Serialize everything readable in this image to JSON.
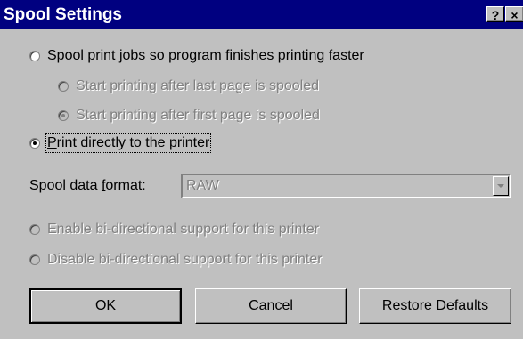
{
  "window": {
    "title": "Spool Settings",
    "help_label": "?",
    "close_label": "×"
  },
  "spool": {
    "main_label": "Spool print jobs so program finishes printing faster",
    "main_mnemonic": "S",
    "main_rest": "pool print jobs so program finishes printing faster",
    "after_last_label": "Start printing after last page is spooled",
    "after_first_label": "Start printing after first page is spooled",
    "direct_mnemonic": "P",
    "direct_rest": "rint directly to the printer"
  },
  "format": {
    "label_pre": "Spool data ",
    "label_mnemonic": "f",
    "label_post": "ormat:",
    "selected": "RAW"
  },
  "bidi": {
    "enable_label": "Enable bi-directional support for this printer",
    "disable_label": "Disable bi-directional support for this printer"
  },
  "buttons": {
    "ok_label": "OK",
    "cancel_label": "Cancel",
    "restore_pre": "Restore ",
    "restore_mnemonic": "D",
    "restore_post": "efaults"
  }
}
